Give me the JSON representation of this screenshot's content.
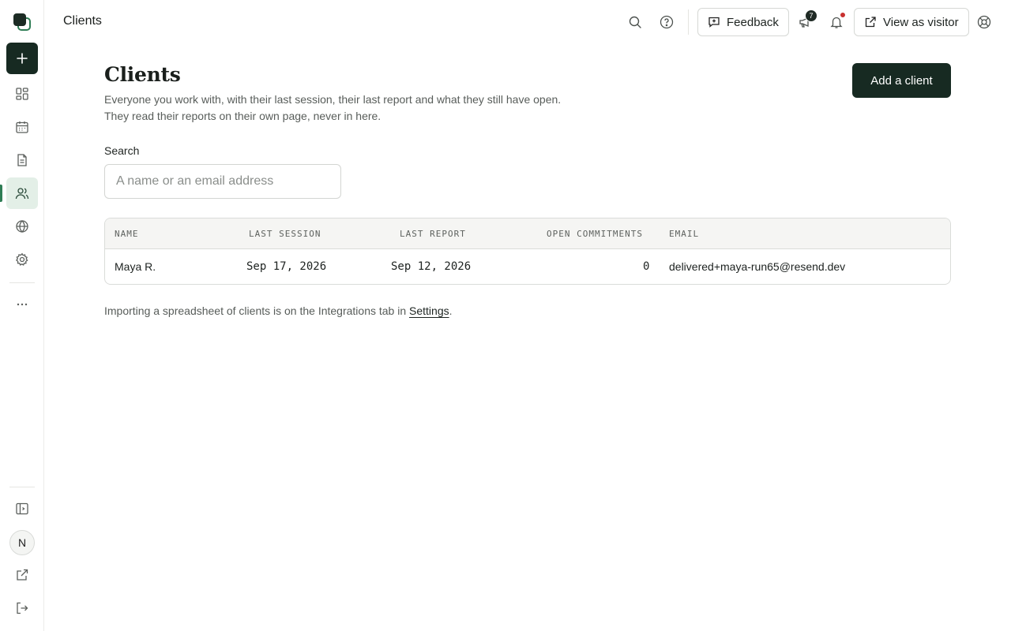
{
  "topbar": {
    "title": "Clients",
    "feedback_label": "Feedback",
    "notification_count": "7",
    "view_as_visitor_label": "View as visitor"
  },
  "sidebar": {
    "avatar_initial": "N",
    "items": [
      {
        "name": "dashboard",
        "icon": "grid-icon"
      },
      {
        "name": "calendar",
        "icon": "calendar-icon"
      },
      {
        "name": "reports",
        "icon": "document-icon"
      },
      {
        "name": "clients",
        "icon": "users-icon",
        "active": true
      },
      {
        "name": "website",
        "icon": "globe-icon"
      },
      {
        "name": "settings",
        "icon": "gear-icon"
      }
    ]
  },
  "main": {
    "title": "Clients",
    "description": "Everyone you work with, with their last session, their last report and what they still have open. They read their reports on their own page, never in here.",
    "add_button_label": "Add a client",
    "search": {
      "label": "Search",
      "placeholder": "A name or an email address",
      "value": ""
    },
    "table": {
      "columns": [
        "NAME",
        "LAST SESSION",
        "LAST REPORT",
        "OPEN COMMITMENTS",
        "EMAIL"
      ],
      "rows": [
        {
          "name": "Maya R.",
          "last_session": "Sep 17, 2026",
          "last_report": "Sep 12, 2026",
          "open_commitments": "0",
          "email": "delivered+maya-run65@resend.dev"
        }
      ]
    },
    "footnote": {
      "text": "Importing a spreadsheet of clients is on the Integrations tab in ",
      "link": "Settings",
      "end": "."
    }
  },
  "colors": {
    "primary_dark": "#172a22",
    "accent_green": "#2f7d55",
    "active_bg": "#e3efe7",
    "notification_dot": "#c8302f"
  }
}
